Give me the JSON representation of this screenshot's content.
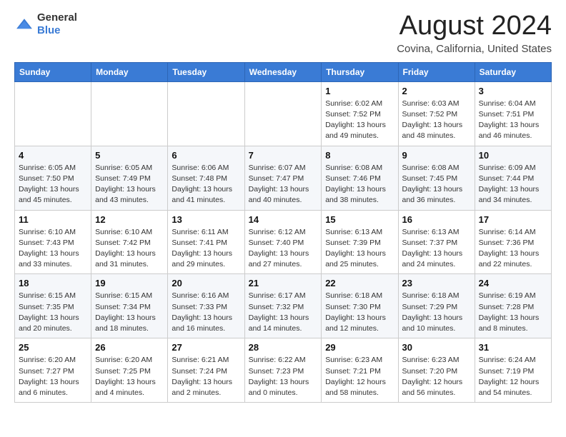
{
  "header": {
    "logo_general": "General",
    "logo_blue": "Blue",
    "main_title": "August 2024",
    "subtitle": "Covina, California, United States"
  },
  "days_of_week": [
    "Sunday",
    "Monday",
    "Tuesday",
    "Wednesday",
    "Thursday",
    "Friday",
    "Saturday"
  ],
  "weeks": [
    [
      {
        "day": "",
        "info": ""
      },
      {
        "day": "",
        "info": ""
      },
      {
        "day": "",
        "info": ""
      },
      {
        "day": "",
        "info": ""
      },
      {
        "day": "1",
        "info": "Sunrise: 6:02 AM\nSunset: 7:52 PM\nDaylight: 13 hours\nand 49 minutes."
      },
      {
        "day": "2",
        "info": "Sunrise: 6:03 AM\nSunset: 7:52 PM\nDaylight: 13 hours\nand 48 minutes."
      },
      {
        "day": "3",
        "info": "Sunrise: 6:04 AM\nSunset: 7:51 PM\nDaylight: 13 hours\nand 46 minutes."
      }
    ],
    [
      {
        "day": "4",
        "info": "Sunrise: 6:05 AM\nSunset: 7:50 PM\nDaylight: 13 hours\nand 45 minutes."
      },
      {
        "day": "5",
        "info": "Sunrise: 6:05 AM\nSunset: 7:49 PM\nDaylight: 13 hours\nand 43 minutes."
      },
      {
        "day": "6",
        "info": "Sunrise: 6:06 AM\nSunset: 7:48 PM\nDaylight: 13 hours\nand 41 minutes."
      },
      {
        "day": "7",
        "info": "Sunrise: 6:07 AM\nSunset: 7:47 PM\nDaylight: 13 hours\nand 40 minutes."
      },
      {
        "day": "8",
        "info": "Sunrise: 6:08 AM\nSunset: 7:46 PM\nDaylight: 13 hours\nand 38 minutes."
      },
      {
        "day": "9",
        "info": "Sunrise: 6:08 AM\nSunset: 7:45 PM\nDaylight: 13 hours\nand 36 minutes."
      },
      {
        "day": "10",
        "info": "Sunrise: 6:09 AM\nSunset: 7:44 PM\nDaylight: 13 hours\nand 34 minutes."
      }
    ],
    [
      {
        "day": "11",
        "info": "Sunrise: 6:10 AM\nSunset: 7:43 PM\nDaylight: 13 hours\nand 33 minutes."
      },
      {
        "day": "12",
        "info": "Sunrise: 6:10 AM\nSunset: 7:42 PM\nDaylight: 13 hours\nand 31 minutes."
      },
      {
        "day": "13",
        "info": "Sunrise: 6:11 AM\nSunset: 7:41 PM\nDaylight: 13 hours\nand 29 minutes."
      },
      {
        "day": "14",
        "info": "Sunrise: 6:12 AM\nSunset: 7:40 PM\nDaylight: 13 hours\nand 27 minutes."
      },
      {
        "day": "15",
        "info": "Sunrise: 6:13 AM\nSunset: 7:39 PM\nDaylight: 13 hours\nand 25 minutes."
      },
      {
        "day": "16",
        "info": "Sunrise: 6:13 AM\nSunset: 7:37 PM\nDaylight: 13 hours\nand 24 minutes."
      },
      {
        "day": "17",
        "info": "Sunrise: 6:14 AM\nSunset: 7:36 PM\nDaylight: 13 hours\nand 22 minutes."
      }
    ],
    [
      {
        "day": "18",
        "info": "Sunrise: 6:15 AM\nSunset: 7:35 PM\nDaylight: 13 hours\nand 20 minutes."
      },
      {
        "day": "19",
        "info": "Sunrise: 6:15 AM\nSunset: 7:34 PM\nDaylight: 13 hours\nand 18 minutes."
      },
      {
        "day": "20",
        "info": "Sunrise: 6:16 AM\nSunset: 7:33 PM\nDaylight: 13 hours\nand 16 minutes."
      },
      {
        "day": "21",
        "info": "Sunrise: 6:17 AM\nSunset: 7:32 PM\nDaylight: 13 hours\nand 14 minutes."
      },
      {
        "day": "22",
        "info": "Sunrise: 6:18 AM\nSunset: 7:30 PM\nDaylight: 13 hours\nand 12 minutes."
      },
      {
        "day": "23",
        "info": "Sunrise: 6:18 AM\nSunset: 7:29 PM\nDaylight: 13 hours\nand 10 minutes."
      },
      {
        "day": "24",
        "info": "Sunrise: 6:19 AM\nSunset: 7:28 PM\nDaylight: 13 hours\nand 8 minutes."
      }
    ],
    [
      {
        "day": "25",
        "info": "Sunrise: 6:20 AM\nSunset: 7:27 PM\nDaylight: 13 hours\nand 6 minutes."
      },
      {
        "day": "26",
        "info": "Sunrise: 6:20 AM\nSunset: 7:25 PM\nDaylight: 13 hours\nand 4 minutes."
      },
      {
        "day": "27",
        "info": "Sunrise: 6:21 AM\nSunset: 7:24 PM\nDaylight: 13 hours\nand 2 minutes."
      },
      {
        "day": "28",
        "info": "Sunrise: 6:22 AM\nSunset: 7:23 PM\nDaylight: 13 hours\nand 0 minutes."
      },
      {
        "day": "29",
        "info": "Sunrise: 6:23 AM\nSunset: 7:21 PM\nDaylight: 12 hours\nand 58 minutes."
      },
      {
        "day": "30",
        "info": "Sunrise: 6:23 AM\nSunset: 7:20 PM\nDaylight: 12 hours\nand 56 minutes."
      },
      {
        "day": "31",
        "info": "Sunrise: 6:24 AM\nSunset: 7:19 PM\nDaylight: 12 hours\nand 54 minutes."
      }
    ]
  ]
}
